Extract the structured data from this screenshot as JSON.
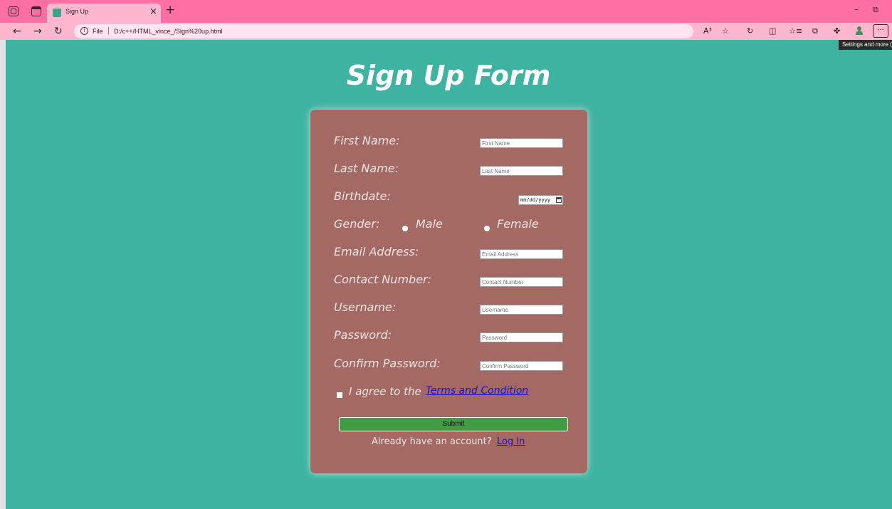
{
  "browser": {
    "tab_title": "Sign Up",
    "tab_close": "×",
    "new_tab": "+",
    "url_scheme": "File",
    "url_separator": "|",
    "url": "D:/c++/HTML_vince_/Sign%20up.html",
    "back": "←",
    "forward": "→",
    "reload": "↻",
    "info": "i",
    "read_aloud": "A³",
    "favorite": "☆",
    "refresh_alt": "↻",
    "split_screen": "◫",
    "favorites": "☆≡",
    "collections": "⧉",
    "extensions": "✤",
    "more": "···",
    "minimize": "–",
    "restore": "⧉",
    "tooltip": "Settings and more (Alt+F)"
  },
  "page": {
    "title": "Sign Up Form"
  },
  "form": {
    "first_name_label": "First Name:",
    "first_name_placeholder": "First Name",
    "last_name_label": "Last Name:",
    "last_name_placeholder": "Last Name",
    "birthdate_label": "Birthdate:",
    "birthdate_value": "mm/dd/yyyy",
    "gender_label": "Gender:",
    "gender_male": "Male",
    "gender_female": "Female",
    "email_label": "Email Address:",
    "email_placeholder": "Email Address",
    "contact_label": "Contact Number:",
    "contact_placeholder": "Contact Number",
    "username_label": "Username:",
    "username_placeholder": "Username",
    "password_label": "Password:",
    "password_placeholder": "Password",
    "confirm_label": "Confirm Password:",
    "confirm_placeholder": "Confirm Password",
    "agree_text": "I agree to the",
    "terms_link": "Terms and Condition",
    "submit_label": "Submit",
    "already_text": "Already have an account?",
    "login_link": "Log In"
  },
  "colors": {
    "page_background": "#3fb3a1",
    "card_background": "#a46963",
    "submit_background": "#429b45",
    "link": "#1a0fd9",
    "browser_frame": "#ff6fa4"
  }
}
